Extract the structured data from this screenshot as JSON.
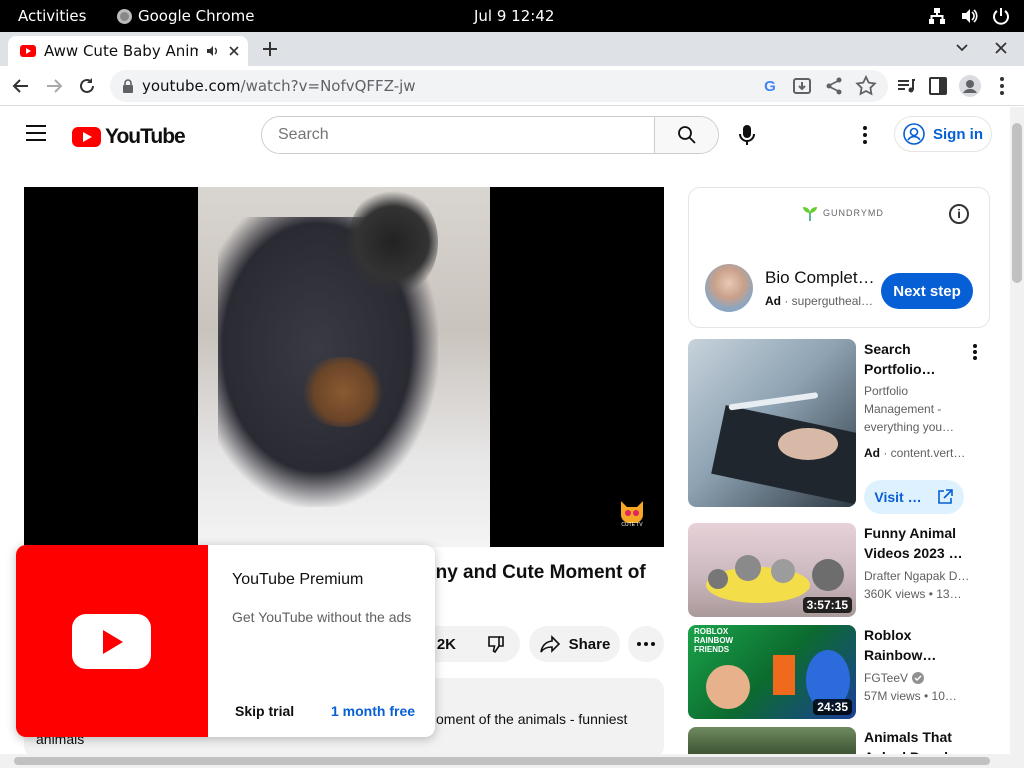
{
  "os_bar": {
    "activities": "Activities",
    "app_name": "Google Chrome",
    "clock": "Jul 9  12:42"
  },
  "browser": {
    "tab_title": "Aww Cute Baby Animals",
    "url_host": "youtube.com",
    "url_path": "/watch?v=NofvQFFZ-jw"
  },
  "youtube": {
    "logo_text": "YouTube",
    "search_placeholder": "Search",
    "sign_in": "Sign in"
  },
  "video": {
    "title_visible": "nny and Cute Moment of",
    "like_count": "2K",
    "share_label": "Share",
    "description_line1": "oment of the animals - funniest",
    "description_line2": "animals",
    "watermark": "CUTE TV"
  },
  "premium_popup": {
    "title": "YouTube Premium",
    "subtitle": "Get YouTube without the ads",
    "skip_label": "Skip trial",
    "free_label": "1 month free"
  },
  "ad_card": {
    "brand": "GUNDRYMD",
    "title": "Bio Complet…",
    "ad_badge": "Ad",
    "advertiser": "supergutheal…",
    "cta": "Next step"
  },
  "sidebar": [
    {
      "title_line1": "Search",
      "title_line2": "Portfolio…",
      "meta1": "Portfolio",
      "meta2": "Management -",
      "meta3": "everything you…",
      "ad_badge": "Ad",
      "advertiser": "content.vert…",
      "cta": "Visit …"
    },
    {
      "title_line1": "Funny Animal",
      "title_line2": "Videos 2023 …",
      "channel": "Drafter Ngapak D…",
      "stats": "360K views  • 13…",
      "duration": "3:57:15"
    },
    {
      "title_line1": "Roblox",
      "title_line2": "Rainbow…",
      "channel": "FGTeeV",
      "stats": "57M views  • 10…",
      "duration": "24:35",
      "thumb_text": "ROBLOX RAINBOW FRIENDS"
    },
    {
      "title_line1": "Animals That",
      "title_line2": "Asked People…"
    }
  ],
  "colors": {
    "brand_red": "#ff0000",
    "link_blue": "#065fd4"
  }
}
